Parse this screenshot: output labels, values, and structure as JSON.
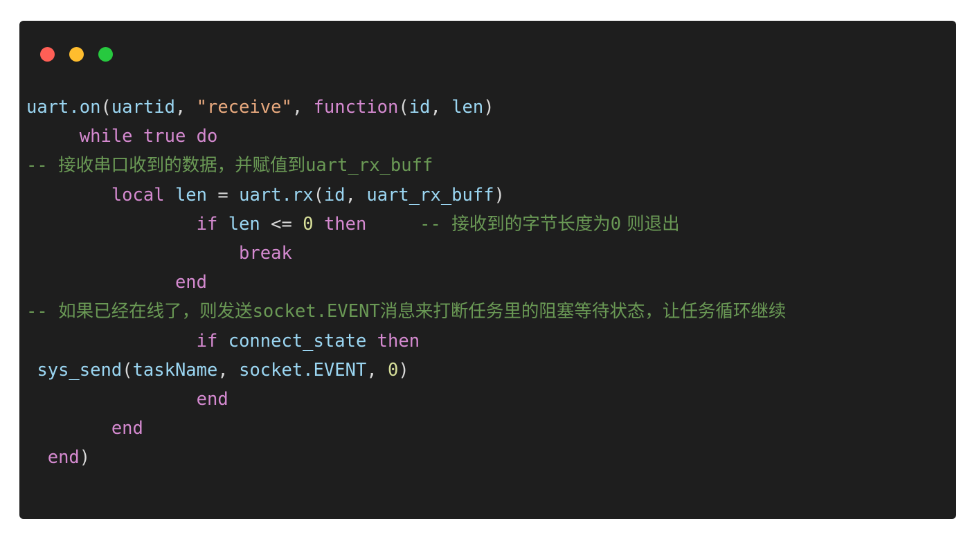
{
  "window": {
    "dots": [
      {
        "name": "close",
        "color": "#ff5f56"
      },
      {
        "name": "minimize",
        "color": "#ffbd2e"
      },
      {
        "name": "maximize",
        "color": "#27c93f"
      }
    ]
  },
  "editor": {
    "language": "lua",
    "background": "#1e1e1e",
    "page_background": "#ffffff",
    "colors": {
      "keyword": "#d58ad0",
      "identifier": "#9bd6f2",
      "string": "#e8a97e",
      "comment": "#6a9955",
      "number": "#d8e09a",
      "operator": "#d8d8d8",
      "default_text": "#d6d6d6"
    },
    "lines": [
      {
        "indent": "",
        "tokens": [
          {
            "t": "uart.on",
            "c": "id"
          },
          {
            "t": "(",
            "c": "pun"
          },
          {
            "t": "uartid",
            "c": "id"
          },
          {
            "t": ", ",
            "c": "pun"
          },
          {
            "t": "\"receive\"",
            "c": "str"
          },
          {
            "t": ", ",
            "c": "pun"
          },
          {
            "t": "function",
            "c": "kw"
          },
          {
            "t": "(",
            "c": "pun"
          },
          {
            "t": "id",
            "c": "id"
          },
          {
            "t": ", ",
            "c": "pun"
          },
          {
            "t": "len",
            "c": "id"
          },
          {
            "t": ")",
            "c": "pun"
          }
        ]
      },
      {
        "indent": "     ",
        "tokens": [
          {
            "t": "while",
            "c": "kw"
          },
          {
            "t": " ",
            "c": "pun"
          },
          {
            "t": "true",
            "c": "kw"
          },
          {
            "t": " ",
            "c": "pun"
          },
          {
            "t": "do",
            "c": "kw"
          }
        ]
      },
      {
        "indent": "",
        "tokens": [
          {
            "t": "-- ",
            "c": "cmt"
          },
          {
            "t": "接收串口收到的数据，并赋值到",
            "c": "cmt cn"
          },
          {
            "t": "uart_rx_buff",
            "c": "cmt"
          }
        ]
      },
      {
        "indent": "        ",
        "tokens": [
          {
            "t": "local",
            "c": "kw"
          },
          {
            "t": " ",
            "c": "pun"
          },
          {
            "t": "len",
            "c": "id"
          },
          {
            "t": " ",
            "c": "pun"
          },
          {
            "t": "=",
            "c": "op"
          },
          {
            "t": " ",
            "c": "pun"
          },
          {
            "t": "uart.rx",
            "c": "id"
          },
          {
            "t": "(",
            "c": "pun"
          },
          {
            "t": "id",
            "c": "id"
          },
          {
            "t": ", ",
            "c": "pun"
          },
          {
            "t": "uart_rx_buff",
            "c": "id"
          },
          {
            "t": ")",
            "c": "pun"
          }
        ]
      },
      {
        "indent": "                ",
        "tokens": [
          {
            "t": "if",
            "c": "kw"
          },
          {
            "t": " ",
            "c": "pun"
          },
          {
            "t": "len",
            "c": "id"
          },
          {
            "t": " ",
            "c": "pun"
          },
          {
            "t": "<=",
            "c": "op"
          },
          {
            "t": " ",
            "c": "pun"
          },
          {
            "t": "0",
            "c": "num"
          },
          {
            "t": " ",
            "c": "pun"
          },
          {
            "t": "then",
            "c": "kw"
          },
          {
            "t": "     ",
            "c": "pun"
          },
          {
            "t": "-- ",
            "c": "cmt"
          },
          {
            "t": "接收到的字节长度为",
            "c": "cmt cn"
          },
          {
            "t": "0",
            "c": "cmt"
          },
          {
            "t": " 则退出",
            "c": "cmt cn"
          }
        ]
      },
      {
        "indent": "                    ",
        "tokens": [
          {
            "t": "break",
            "c": "kw"
          }
        ]
      },
      {
        "indent": "              ",
        "tokens": [
          {
            "t": "end",
            "c": "kw"
          }
        ]
      },
      {
        "indent": "",
        "tokens": [
          {
            "t": "-- ",
            "c": "cmt"
          },
          {
            "t": "如果已经在线了，则发送",
            "c": "cmt cn"
          },
          {
            "t": "socket.EVENT",
            "c": "cmt"
          },
          {
            "t": "消息来打断任务里的阻塞等待状态，让任务循环继续",
            "c": "cmt cn"
          }
        ]
      },
      {
        "indent": "                ",
        "tokens": [
          {
            "t": "if",
            "c": "kw"
          },
          {
            "t": " ",
            "c": "pun"
          },
          {
            "t": "connect_state",
            "c": "id"
          },
          {
            "t": " ",
            "c": "pun"
          },
          {
            "t": "then",
            "c": "kw"
          }
        ]
      },
      {
        "indent": " ",
        "tokens": [
          {
            "t": "sys_send",
            "c": "id"
          },
          {
            "t": "(",
            "c": "pun"
          },
          {
            "t": "taskName",
            "c": "id"
          },
          {
            "t": ", ",
            "c": "pun"
          },
          {
            "t": "socket.EVENT",
            "c": "id"
          },
          {
            "t": ", ",
            "c": "pun"
          },
          {
            "t": "0",
            "c": "num"
          },
          {
            "t": ")",
            "c": "pun"
          }
        ]
      },
      {
        "indent": "                ",
        "tokens": [
          {
            "t": "end",
            "c": "kw"
          }
        ]
      },
      {
        "indent": "        ",
        "tokens": [
          {
            "t": "end",
            "c": "kw"
          }
        ]
      },
      {
        "indent": "  ",
        "tokens": [
          {
            "t": "end",
            "c": "kw"
          },
          {
            "t": ")",
            "c": "pun"
          }
        ]
      }
    ]
  }
}
